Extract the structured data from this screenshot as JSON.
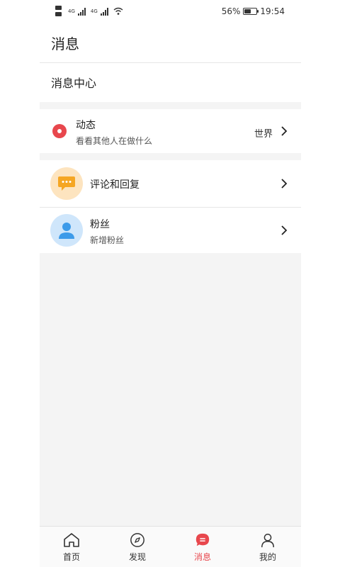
{
  "status_bar": {
    "network_1": "4G",
    "network_2": "4G",
    "battery_percent": "56%",
    "battery_level": 0.56,
    "time": "19:54"
  },
  "header": {
    "title": "消息"
  },
  "section": {
    "title": "消息中心"
  },
  "feed_row": {
    "title": "动态",
    "subtitle": "看看其他人在做什么",
    "trailing_label": "世界",
    "icon": "location-dot-icon"
  },
  "comments_row": {
    "title": "评论和回复",
    "icon": "chat-bubble-icon"
  },
  "fans_row": {
    "title": "粉丝",
    "subtitle": "新增粉丝",
    "icon": "user-icon"
  },
  "bottom_nav": {
    "items": [
      {
        "label": "首页",
        "icon": "home-icon"
      },
      {
        "label": "发现",
        "icon": "compass-icon"
      },
      {
        "label": "消息",
        "icon": "message-icon",
        "active": true
      },
      {
        "label": "我的",
        "icon": "profile-icon"
      }
    ]
  },
  "colors": {
    "accent": "#e8474d",
    "chat_icon_bg": "#fde4bf",
    "chat_icon_fg": "#f5a623",
    "user_icon_bg": "#cfe6fb",
    "user_icon_fg": "#3d9be9",
    "page_gray": "#f4f4f4"
  }
}
